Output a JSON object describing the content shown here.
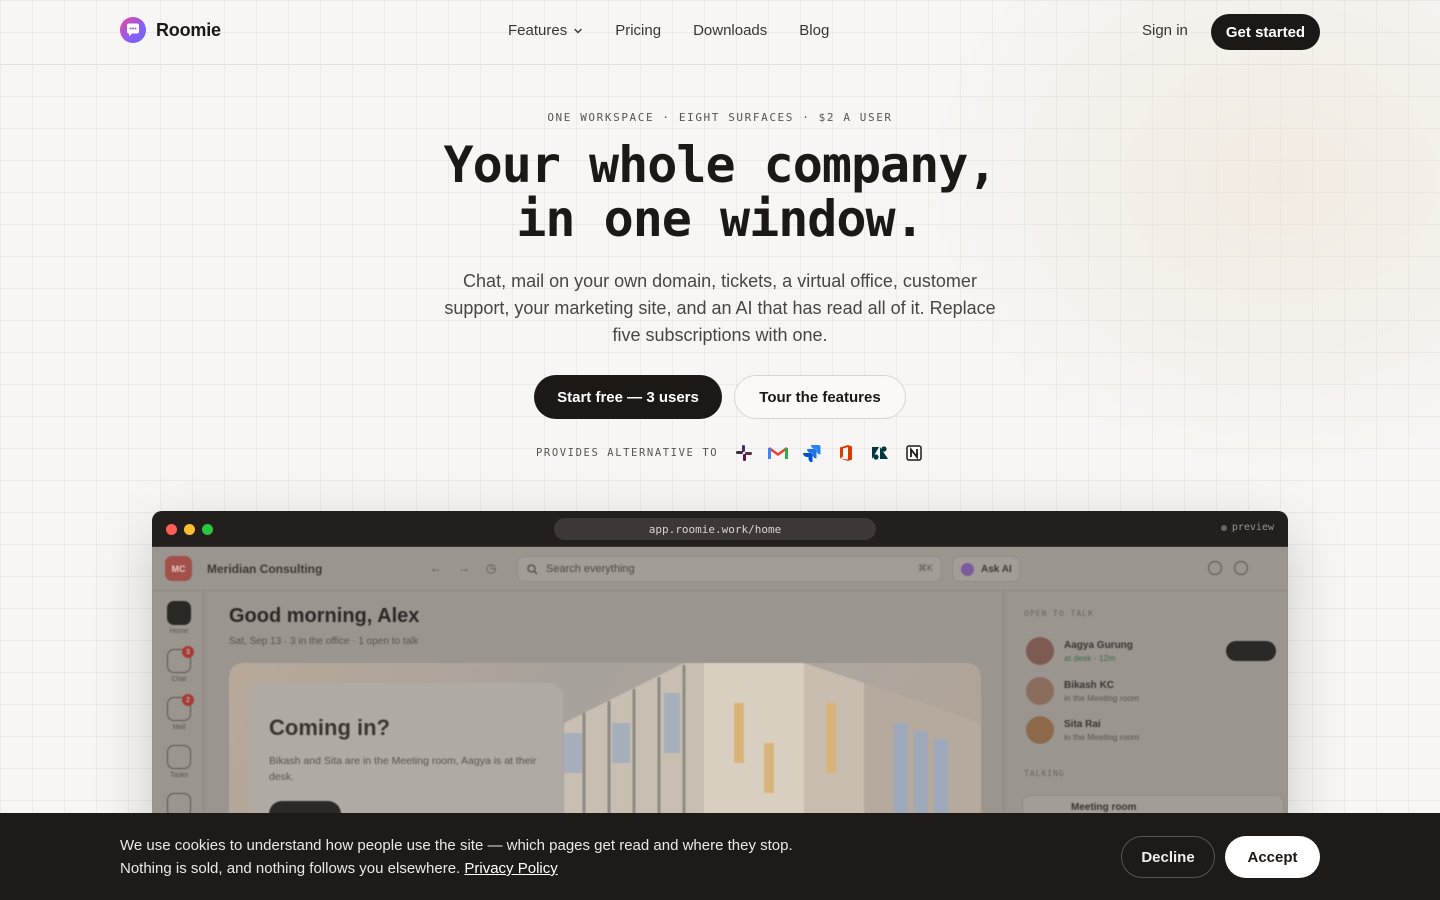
{
  "brand": {
    "name": "Roomie"
  },
  "nav": {
    "links": [
      {
        "label": "Features",
        "has_dropdown": true
      },
      {
        "label": "Pricing"
      },
      {
        "label": "Downloads"
      },
      {
        "label": "Blog"
      }
    ],
    "sign_in": "Sign in",
    "get_started": "Get started"
  },
  "hero": {
    "eyebrow": "ONE WORKSPACE · EIGHT SURFACES · $2 A USER",
    "headline_line1": "Your whole company,",
    "headline_line2": "in one window.",
    "subhead": "Chat, mail on your own domain, tickets, a virtual office, customer support, your marketing site, and an AI that has read all of it. Replace five subscriptions with one.",
    "cta_primary": "Start free — 3 users",
    "cta_secondary": "Tour the features",
    "alternatives_label": "PROVIDES ALTERNATIVE TO",
    "alternatives": [
      "slack-icon",
      "gmail-icon",
      "jira-icon",
      "office-icon",
      "zendesk-icon",
      "notion-icon"
    ]
  },
  "preview": {
    "url": "app.roomie.work/home",
    "tag": "preview",
    "app": {
      "workspace_initials": "MC",
      "workspace_name": "Meridian Consulting",
      "search_placeholder": "Search everything",
      "search_shortcut": "⌘K",
      "ask_ai": "Ask AI",
      "rail": [
        {
          "label": "Home",
          "badge": ""
        },
        {
          "label": "Chat",
          "badge": "3"
        },
        {
          "label": "Mail",
          "badge": "2"
        },
        {
          "label": "Tasks",
          "badge": ""
        }
      ],
      "greeting": "Good morning, Alex",
      "greeting_sub": "Sat, Sep 13 · 3 in the office · 1 open to talk",
      "card_title": "Coming in?",
      "card_sub": "Bikash and Sita are in the Meeting room, Aagya is at their desk.",
      "open_to_talk_label": "OPEN TO TALK",
      "people": [
        {
          "name": "Aagya Gurung",
          "status": "at desk · 12m"
        },
        {
          "name": "Bikash KC",
          "status": "in the Meeting room"
        },
        {
          "name": "Sita Rai",
          "status": "in the Meeting room"
        }
      ],
      "talking_label": "TALKING",
      "room_name": "Meeting room"
    }
  },
  "cookie": {
    "text_line1": "We use cookies to understand how people use the site — which pages get read and where they stop.",
    "text_line2": "Nothing is sold, and nothing follows you elsewhere.",
    "link": "Privacy Policy",
    "decline": "Decline",
    "accept": "Accept"
  },
  "colors": {
    "ink": "#1c1816",
    "background": "#f7f6f4",
    "banner": "#1e1a18",
    "brand_gradient": [
      "#ec4899",
      "#8b5cf6",
      "#6366f1"
    ]
  }
}
